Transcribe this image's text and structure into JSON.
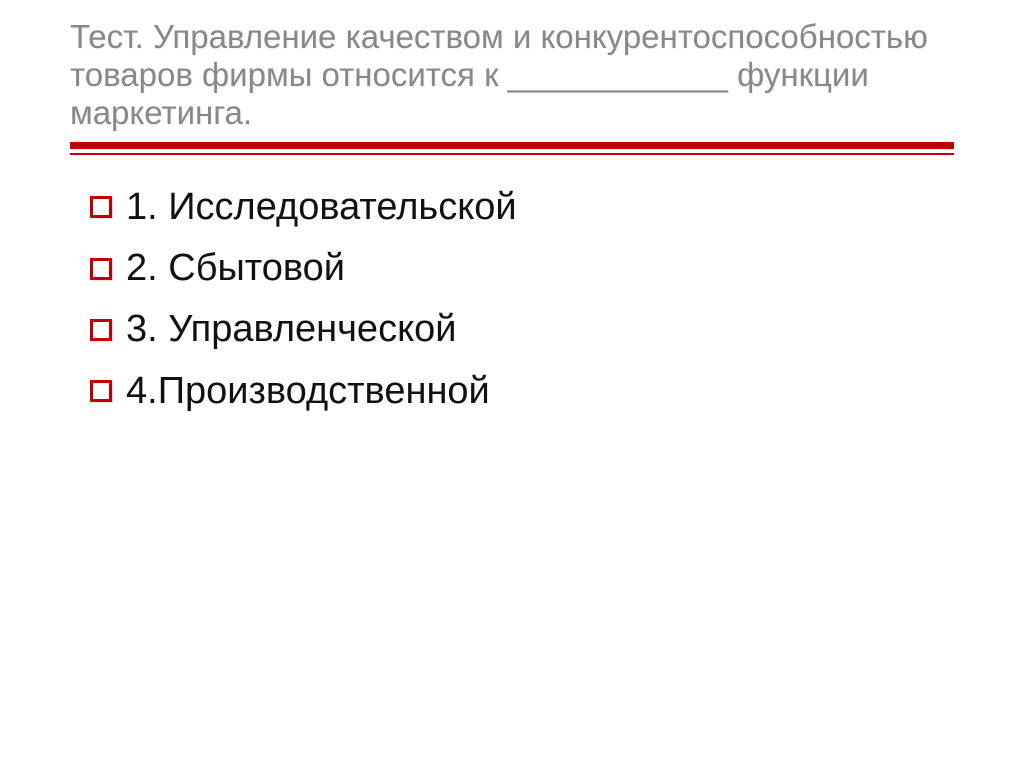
{
  "title": "Тест. Управление качеством и конкурентоспособностью товаров фирмы относится к ____________ функции маркетинга.",
  "options": [
    {
      "label": "1. Исследовательской"
    },
    {
      "label": "2. Сбытовой"
    },
    {
      "label": "3. Управленческой"
    },
    {
      "label": "4.Производственной"
    }
  ]
}
